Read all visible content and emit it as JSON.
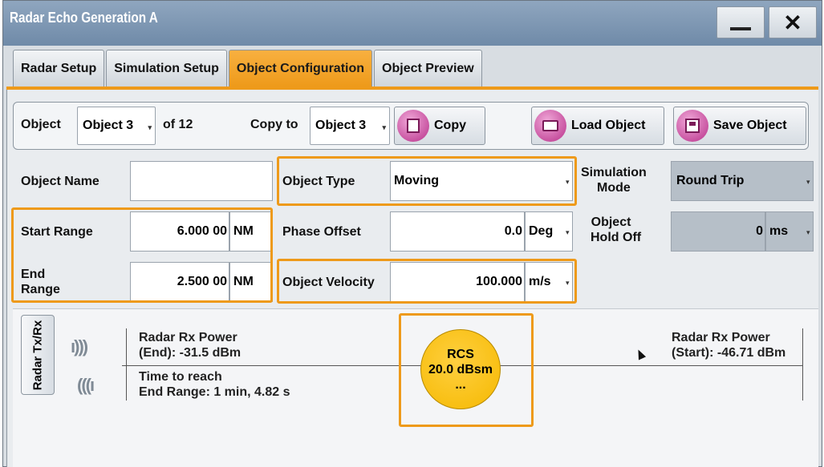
{
  "window": {
    "title": "Radar Echo Generation A",
    "close_glyph": "✕"
  },
  "tabs": [
    {
      "label": "Radar Setup"
    },
    {
      "label": "Simulation Setup"
    },
    {
      "label": "Object Configuration"
    },
    {
      "label": "Object Preview"
    }
  ],
  "object_row": {
    "object_label": "Object",
    "object_value": "Object 3",
    "of_text": "of 12",
    "copy_to_label": "Copy to",
    "copy_to_value": "Object 3",
    "copy_button": "Copy",
    "load_button": "Load Object",
    "save_button": "Save Object"
  },
  "fields": {
    "object_name_label": "Object Name",
    "object_name_value": "",
    "object_type_label": "Object Type",
    "object_type_value": "Moving",
    "simulation_mode_label_1": "Simulation",
    "simulation_mode_label_2": "Mode",
    "simulation_mode_value": "Round Trip",
    "start_range_label": "Start Range",
    "start_range_value": "6.000 00",
    "start_range_unit": "NM",
    "phase_offset_label": "Phase Offset",
    "phase_offset_value": "0.0",
    "phase_offset_unit": "Deg",
    "object_hold_off_label_1": "Object",
    "object_hold_off_label_2": "Hold Off",
    "object_hold_off_value": "0",
    "object_hold_off_unit": "ms",
    "end_range_label_1": "End",
    "end_range_label_2": "Range",
    "end_range_value": "2.500 00",
    "end_range_unit": "NM",
    "object_velocity_label": "Object Velocity",
    "object_velocity_value": "100.000",
    "object_velocity_unit": "m/s"
  },
  "visual": {
    "radar_button": "Radar Tx/Rx",
    "rx_end_line1": "Radar Rx Power",
    "rx_end_line2": "(End): -31.5 dBm",
    "time_line1": "Time to reach",
    "time_line2": "End Range: 1 min, 4.82 s",
    "rcs_line1": "RCS",
    "rcs_line2": "20.0 dBsm",
    "rcs_line3": "...",
    "rx_start_line1": "Radar Rx Power",
    "rx_start_line2": "(Start): -46.71 dBm"
  },
  "colors": {
    "accent": "#ee9a1a",
    "rcs": "#f5b800",
    "title_bar": "#7a93ae"
  }
}
